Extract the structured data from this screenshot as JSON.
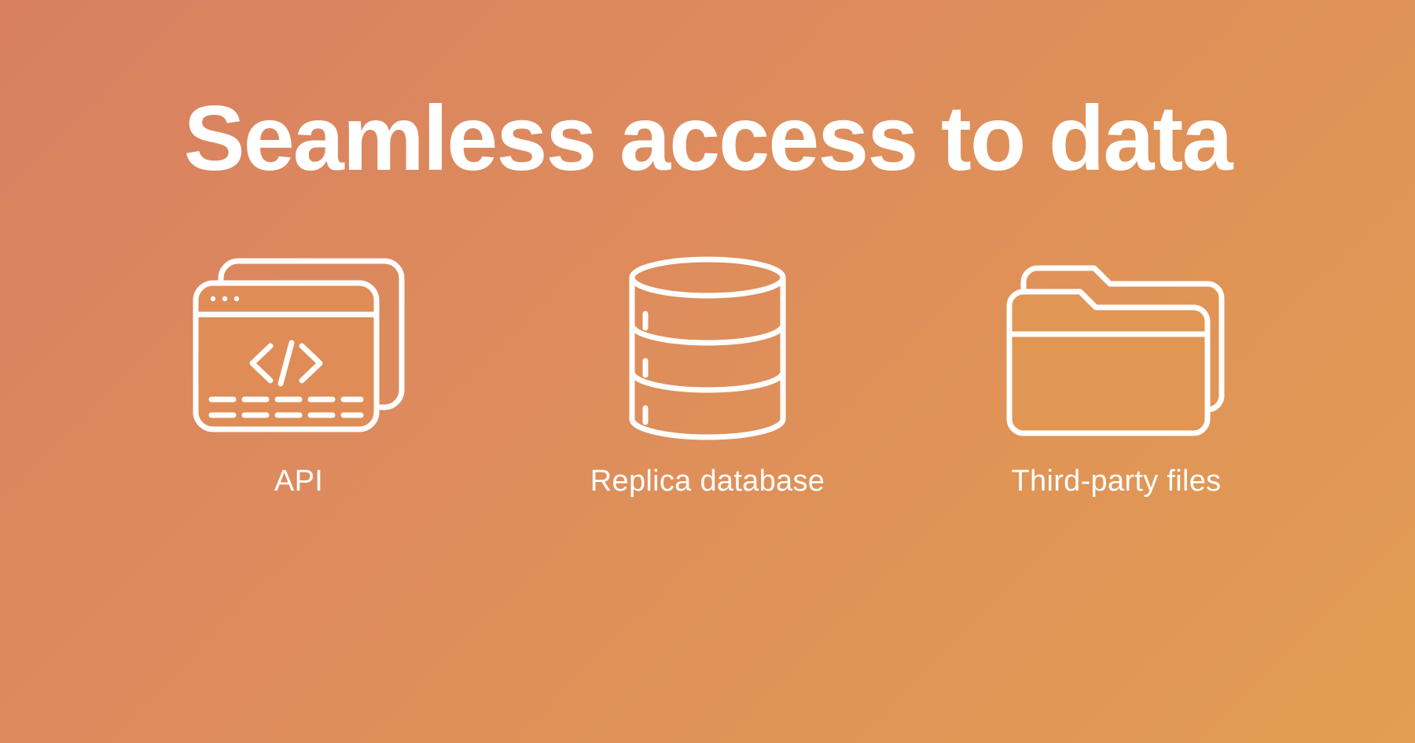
{
  "title": "Seamless access to data",
  "items": [
    {
      "icon": "api-icon",
      "label": "API"
    },
    {
      "icon": "database-icon",
      "label": "Replica database"
    },
    {
      "icon": "folder-icon",
      "label": "Third-party files"
    }
  ],
  "colors": {
    "foreground": "#ffffff",
    "background_gradient_start": "#d88060",
    "background_gradient_end": "#e29e54"
  }
}
